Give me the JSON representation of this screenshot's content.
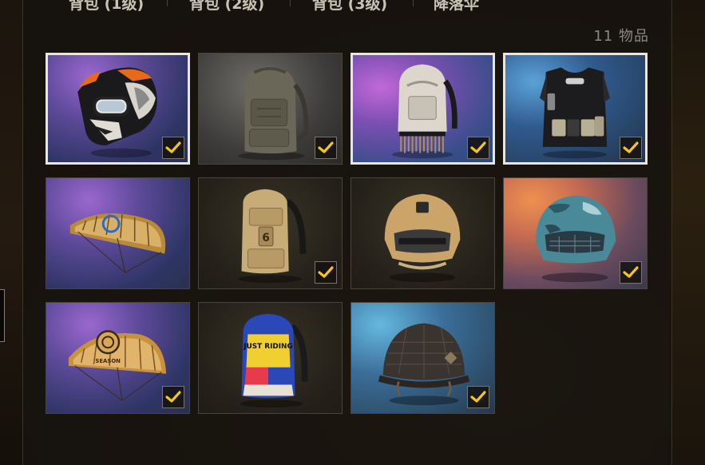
{
  "tabs": [
    "背包 (1级)",
    "背包 (2级)",
    "背包 (3级)",
    "降落伞"
  ],
  "item_count": "11 物品",
  "colors": {
    "check": "#f5c518",
    "selected_border": "#e9e6df"
  },
  "items": [
    {
      "name": "motocross-helmet",
      "icon": "helmet-icon",
      "selected": true,
      "checked": true
    },
    {
      "name": "grey-backpack",
      "icon": "backpack-icon",
      "selected": false,
      "checked": true
    },
    {
      "name": "white-fringe-backpack",
      "icon": "backpack-icon",
      "selected": true,
      "checked": true
    },
    {
      "name": "black-vest",
      "icon": "vest-icon",
      "selected": true,
      "checked": true
    },
    {
      "name": "gold-parachute",
      "icon": "parachute-icon",
      "selected": false,
      "checked": false
    },
    {
      "name": "tan-backpack",
      "icon": "backpack-icon",
      "selected": false,
      "checked": true
    },
    {
      "name": "tan-level3-helmet",
      "icon": "helmet-icon",
      "selected": false,
      "checked": false
    },
    {
      "name": "blue-camo-helmet",
      "icon": "helmet-icon",
      "selected": false,
      "checked": true
    },
    {
      "name": "season-parachute",
      "icon": "parachute-icon",
      "selected": false,
      "checked": true
    },
    {
      "name": "just-riding-backpack",
      "icon": "backpack-icon",
      "selected": false,
      "checked": false
    },
    {
      "name": "patterned-helmet",
      "icon": "helmet-icon",
      "selected": false,
      "checked": true
    }
  ],
  "art_text": {
    "season": "SEASON",
    "just_riding": "JUST RIDING",
    "level": "6"
  }
}
